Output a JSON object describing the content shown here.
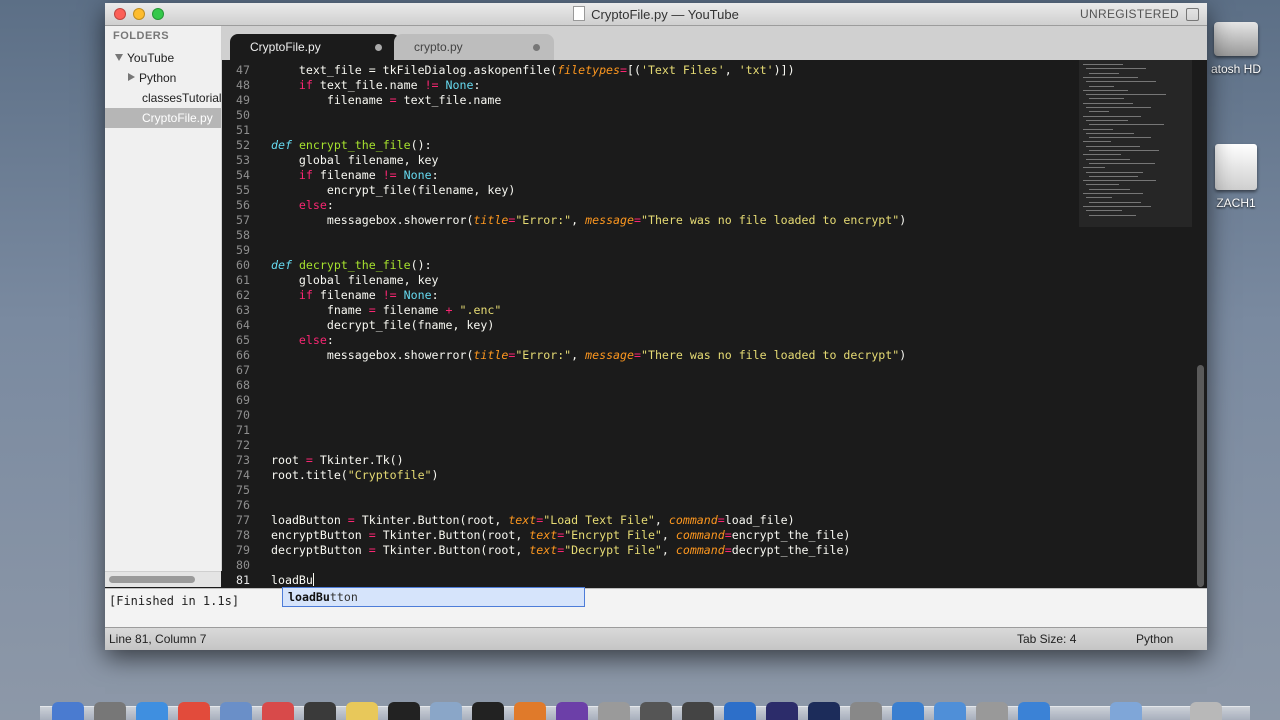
{
  "window": {
    "title": "CryptoFile.py — YouTube",
    "unregistered": "UNREGISTERED"
  },
  "desktop": {
    "icons": [
      {
        "label": "atosh HD",
        "icon": "hard-drive-icon"
      },
      {
        "label": "ZACH1",
        "icon": "usb-drive-icon"
      }
    ]
  },
  "sidebar": {
    "header": "FOLDERS",
    "items": [
      {
        "label": "YouTube",
        "expanded": true
      },
      {
        "label": "Python",
        "expanded": false
      },
      {
        "label": "classesTutorial"
      },
      {
        "label": "CryptoFile.py",
        "selected": true
      }
    ]
  },
  "tabs": [
    {
      "label": "CryptoFile.py",
      "active": true,
      "dirty": true
    },
    {
      "label": "crypto.py",
      "active": false,
      "dirty": true
    }
  ],
  "editor": {
    "line_numbers": [
      "47",
      "48",
      "49",
      "50",
      "51",
      "52",
      "53",
      "54",
      "55",
      "56",
      "57",
      "58",
      "59",
      "60",
      "61",
      "62",
      "63",
      "64",
      "65",
      "66",
      "67",
      "68",
      "69",
      "70",
      "71",
      "72",
      "73",
      "74",
      "75",
      "76",
      "77",
      "78",
      "79",
      "80",
      "81"
    ],
    "current_line": "81",
    "lines": {
      "l47": {
        "a": "    text_file = tkFileDialog.askopenfile(",
        "b": "filetypes",
        "c": "=",
        "d": "[(",
        "e": "'Text Files'",
        "f": ", ",
        "g": "'txt'",
        "h": ")])"
      },
      "l48": {
        "a": "    ",
        "b": "if",
        "c": " text_file.name ",
        "d": "!=",
        "e": " ",
        "f": "None",
        "g": ":"
      },
      "l49": {
        "a": "        filename ",
        "b": "=",
        "c": " text_file.name"
      },
      "l52": {
        "a": "def",
        "b": " ",
        "c": "encrypt_the_file",
        "d": "():"
      },
      "l53": {
        "a": "    global filename, key"
      },
      "l54": {
        "a": "    ",
        "b": "if",
        "c": " filename ",
        "d": "!=",
        "e": " ",
        "f": "None",
        "g": ":"
      },
      "l55": {
        "a": "        encrypt_file(filename, key)"
      },
      "l56": {
        "a": "    ",
        "b": "else",
        "c": ":"
      },
      "l57": {
        "a": "        messagebox.showerror(",
        "b": "title",
        "c": "=",
        "d": "\"Error:\"",
        "e": ", ",
        "f": "message",
        "g": "=",
        "h": "\"There was no file loaded to encrypt\"",
        "i": ")"
      },
      "l60": {
        "a": "def",
        "b": " ",
        "c": "decrypt_the_file",
        "d": "():"
      },
      "l61": {
        "a": "    global filename, key"
      },
      "l62": {
        "a": "    ",
        "b": "if",
        "c": " filename ",
        "d": "!=",
        "e": " ",
        "f": "None",
        "g": ":"
      },
      "l63": {
        "a": "        fname ",
        "b": "=",
        "c": " filename ",
        "d": "+",
        "e": " ",
        "f": "\".enc\""
      },
      "l64": {
        "a": "        decrypt_file(fname, key)"
      },
      "l65": {
        "a": "    ",
        "b": "else",
        "c": ":"
      },
      "l66": {
        "a": "        messagebox.showerror(",
        "b": "title",
        "c": "=",
        "d": "\"Error:\"",
        "e": ", ",
        "f": "message",
        "g": "=",
        "h": "\"There was no file loaded to decrypt\"",
        "i": ")"
      },
      "l72": {
        "a": "root ",
        "b": "=",
        "c": " Tkinter.Tk()"
      },
      "l73": {
        "a": "root.title(",
        "b": "\"Cryptofile\"",
        "c": ")"
      },
      "l77": {
        "a": "loadButton ",
        "b": "=",
        "c": " Tkinter.Button(root, ",
        "d": "text",
        "e": "=",
        "f": "\"Load Text File\"",
        "g": ", ",
        "h": "command",
        "i": "=",
        "j": "load_file)"
      },
      "l78": {
        "a": "encryptButton ",
        "b": "=",
        "c": " Tkinter.Button(root, ",
        "d": "text",
        "e": "=",
        "f": "\"Encrypt File\"",
        "g": ", ",
        "h": "command",
        "i": "=",
        "j": "encrypt_the_file)"
      },
      "l79": {
        "a": "decryptButton ",
        "b": "=",
        "c": " Tkinter.Button(root, ",
        "d": "text",
        "e": "=",
        "f": "\"Decrypt File\"",
        "g": ", ",
        "h": "command",
        "i": "=",
        "j": "decrypt_the_file)"
      },
      "l81": {
        "a": "loadBu"
      }
    }
  },
  "autocomplete": {
    "typed": "loadBu",
    "rest": "tton"
  },
  "output": {
    "text": "[Finished in 1.1s]"
  },
  "status": {
    "position": "Line 81, Column 7",
    "tab_size": "Tab Size: 4",
    "syntax": "Python"
  },
  "colors": {
    "keyword": "#f92672",
    "function": "#a6e22e",
    "string": "#e6db74",
    "constant": "#66d9ef",
    "argument": "#fd971f",
    "editor_bg": "#1b1b1b"
  }
}
